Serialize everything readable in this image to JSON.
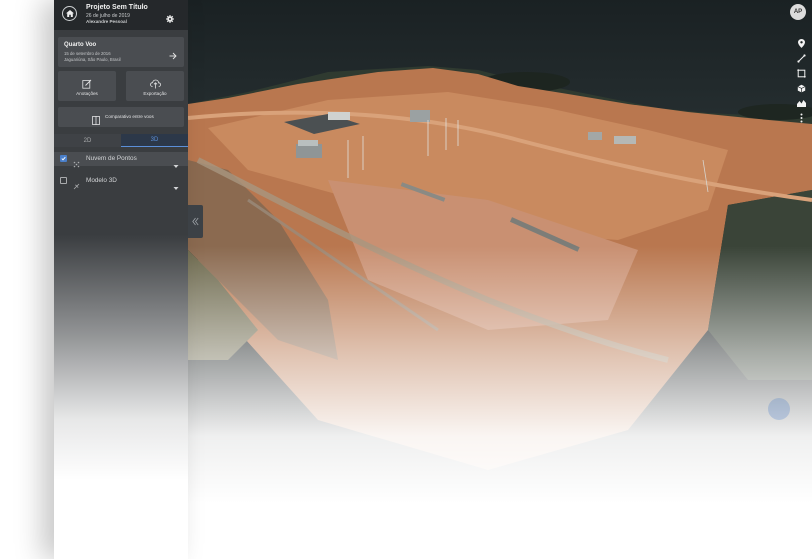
{
  "project": {
    "title": "Projeto Sem Título",
    "date": "26 de julho de 2019",
    "user": "Alexandre Pessoal"
  },
  "flight": {
    "name": "Quarto Voo",
    "date": "15 de setembro de 2016",
    "location": "Jaguariúna, São Paulo, Brasil"
  },
  "actions": {
    "annotations": "Anotações",
    "export": "Exportação",
    "compare": "Comparativo entre voos"
  },
  "view_tabs": [
    {
      "label": "2D",
      "active": false
    },
    {
      "label": "3D",
      "active": true
    }
  ],
  "layers": [
    {
      "label": "Nuvem de Pontos",
      "checked": true,
      "icon": "point-cloud-icon"
    },
    {
      "label": "Modelo 3D",
      "checked": false,
      "icon": "model-3d-icon"
    }
  ],
  "user_avatar": "AP",
  "map_tools": [
    "location-pin-icon",
    "measure-line-icon",
    "area-square-icon",
    "volume-cube-icon",
    "elevation-profile-icon",
    "more-vertical-icon"
  ],
  "colors": {
    "accent": "#5b8fd9",
    "sidebar": "#3a3d40",
    "header": "#25282b",
    "card": "#4a4d51"
  }
}
